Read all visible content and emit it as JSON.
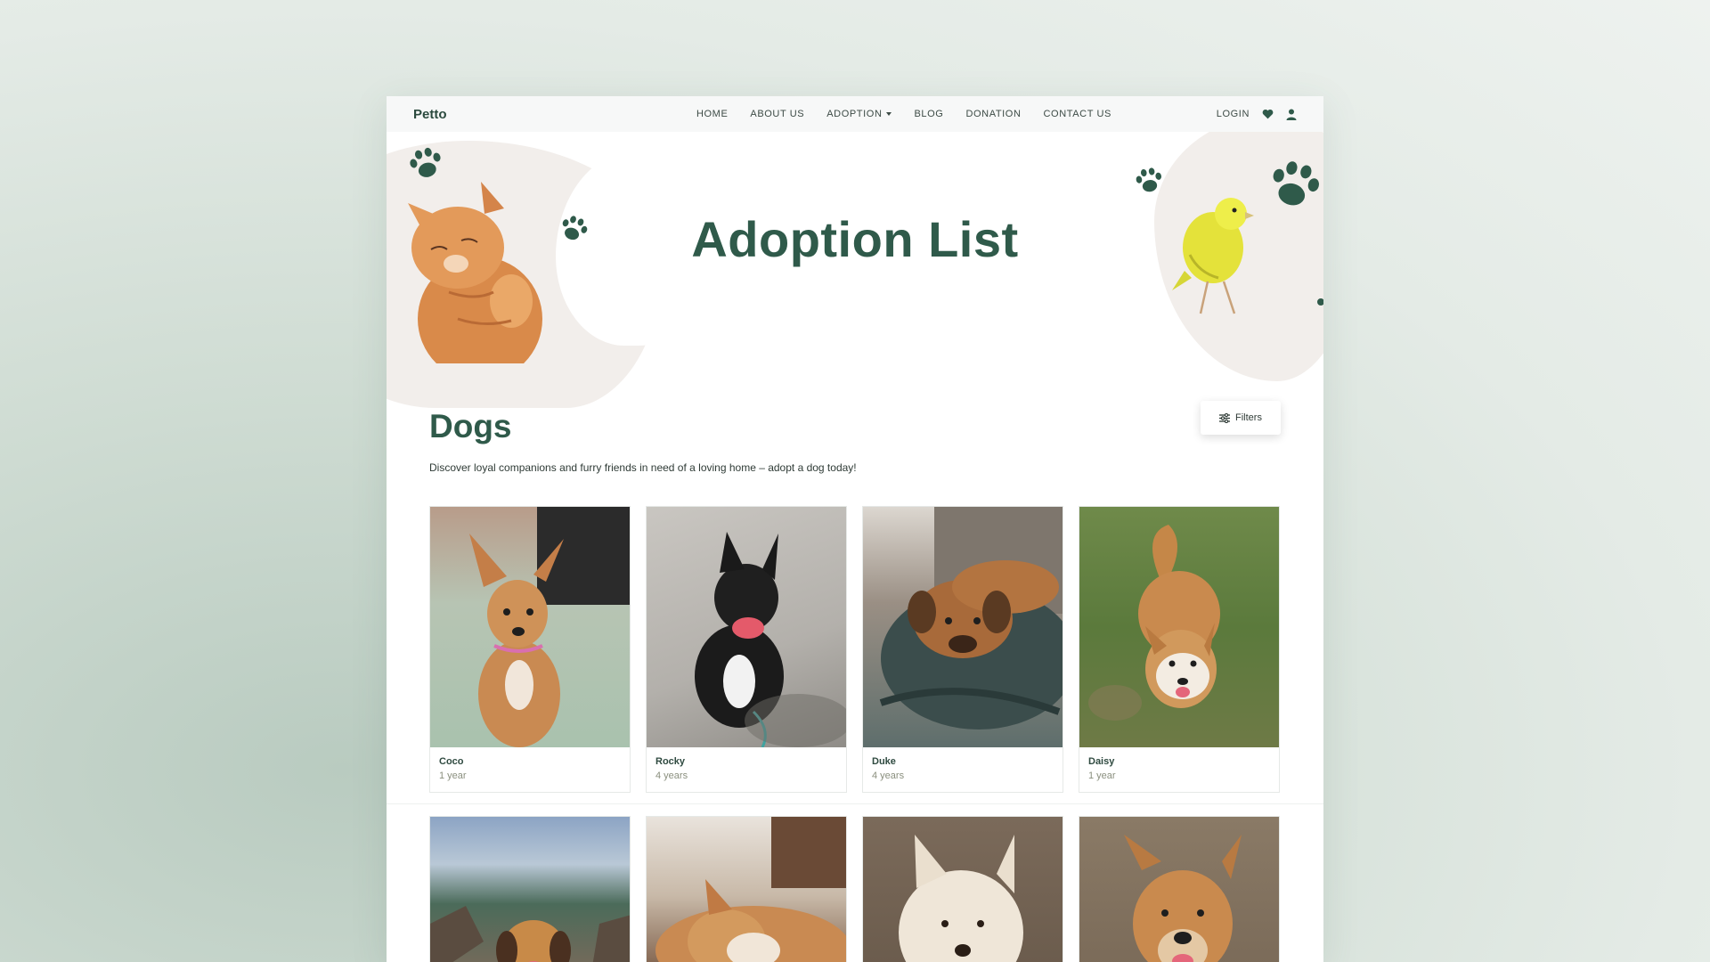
{
  "brand": "Petto",
  "nav": {
    "items": [
      "HOME",
      "ABOUT US",
      "ADOPTION",
      "BLOG",
      "DONATION",
      "CONTACT US"
    ],
    "login": "LOGIN"
  },
  "hero": {
    "title": "Adoption List"
  },
  "section": {
    "title": "Dogs",
    "description": "Discover loyal companions and furry friends in need of a loving home – adopt a dog today!",
    "filters_label": "Filters"
  },
  "pets": [
    {
      "name": "Coco",
      "age": "1 year"
    },
    {
      "name": "Rocky",
      "age": "4 years"
    },
    {
      "name": "Duke",
      "age": "4 years"
    },
    {
      "name": "Daisy",
      "age": "1 year"
    }
  ],
  "colors": {
    "accent": "#2f5a4a",
    "paw": "#2f5a4a",
    "blob": "#f2eeeb",
    "age_text": "#8a8f7e"
  },
  "icons": [
    "heart-icon",
    "user-icon",
    "filter-icon",
    "paw-icon"
  ]
}
